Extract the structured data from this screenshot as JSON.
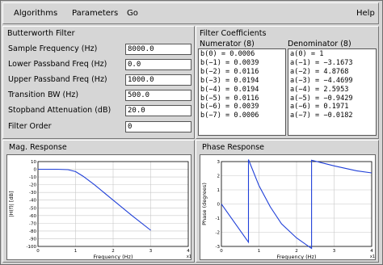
{
  "menubar": {
    "items": [
      "Algorithms",
      "Parameters",
      "Go"
    ],
    "help": "Help"
  },
  "design": {
    "title": "Butterworth Filter",
    "fields": [
      {
        "label": "Sample Frequency (Hz)",
        "value": "8000.0"
      },
      {
        "label": "Lower Passband Freq (Hz)",
        "value": "0.0"
      },
      {
        "label": "Upper Passband Freq (Hz)",
        "value": "1000.0"
      },
      {
        "label": "Transition BW (Hz)",
        "value": "500.0"
      },
      {
        "label": "Stopband Attenuation (dB)",
        "value": "20.0"
      },
      {
        "label": "Filter Order",
        "value": "0"
      }
    ]
  },
  "coefficients": {
    "title": "Filter Coefficients",
    "numerator_label": "Numerator (8)",
    "denominator_label": "Denominator (8)",
    "numerator": [
      "b(0) = 0.0006",
      "b(−1) = 0.0039",
      "b(−2) = 0.0116",
      "b(−3) = 0.0194",
      "b(−4) = 0.0194",
      "b(−5) = 0.0116",
      "b(−6) = 0.0039",
      "b(−7) = 0.0006"
    ],
    "denominator": [
      "a(0) = 1",
      "a(−1) = −3.1673",
      "a(−2) = 4.8768",
      "a(−3) = −4.4699",
      "a(−4) = 2.5953",
      "a(−5) = −0.9429",
      "a(−6) = 0.1971",
      "a(−7) = −0.0182"
    ]
  },
  "chart_data": [
    {
      "type": "line",
      "title": "Mag. Response",
      "xlabel": "Frequency (Hz)",
      "ylabel": "|H(f)| [dB]",
      "x_multiplier": "x1",
      "xlim": [
        0,
        4
      ],
      "ylim": [
        -100,
        10
      ],
      "xticks": [
        0,
        1,
        2,
        3,
        4
      ],
      "yticks": [
        10,
        0,
        -10,
        -20,
        -30,
        -40,
        -50,
        -60,
        -70,
        -80,
        -90,
        -100
      ],
      "grid": true,
      "color": "#1f3fd8",
      "series": [
        {
          "x": [
            0,
            0.5,
            0.8,
            1.0,
            1.2,
            1.5,
            2.0,
            2.5,
            3.0
          ],
          "values": [
            0,
            0,
            -0.5,
            -3,
            -9,
            -20,
            -40,
            -60,
            -79
          ]
        }
      ]
    },
    {
      "type": "line",
      "title": "Phase Response",
      "xlabel": "Frequency (Hz)",
      "ylabel": "Phase (degrees)",
      "x_multiplier": "x1",
      "xlim": [
        0,
        4
      ],
      "ylim": [
        -3,
        3
      ],
      "xticks": [
        0,
        1,
        2,
        3,
        4
      ],
      "yticks": [
        3,
        2,
        1,
        0,
        -1,
        -2,
        -3
      ],
      "grid": true,
      "color": "#1f3fd8",
      "series": [
        {
          "x": [
            0,
            0.72,
            0.72,
            1.0,
            1.3,
            1.6,
            2.0,
            2.4,
            2.4,
            3.0,
            3.6,
            4.0
          ],
          "values": [
            0,
            -2.7,
            3.14,
            1.3,
            -0.2,
            -1.4,
            -2.4,
            -3.14,
            3.1,
            2.7,
            2.35,
            2.2
          ]
        }
      ]
    }
  ]
}
